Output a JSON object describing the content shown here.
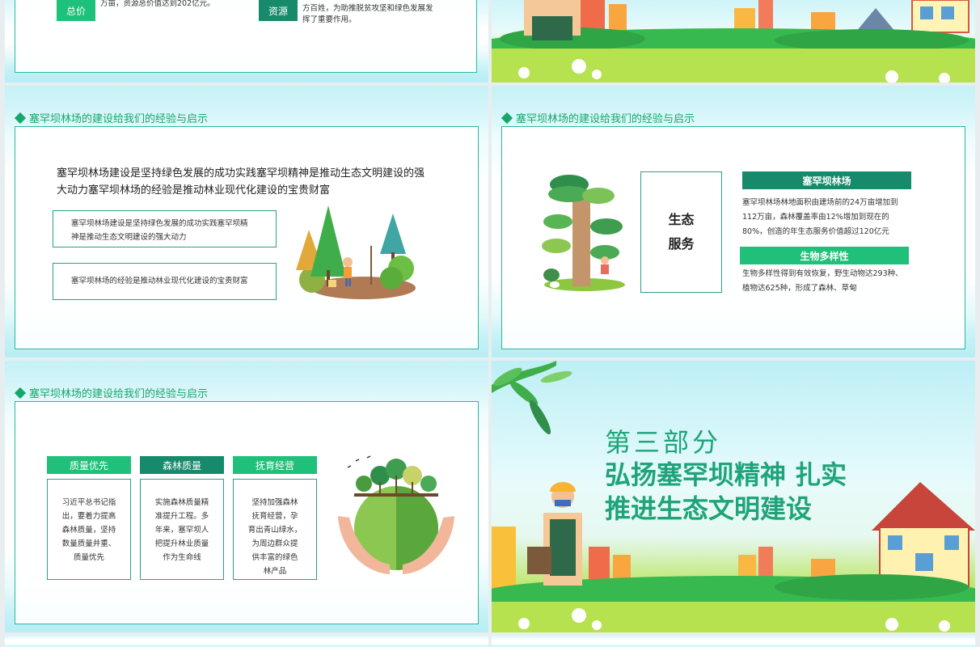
{
  "slide1": {
    "label_a": "总价",
    "text_a": "万亩，资源总价值达到202亿元。",
    "label_b": "资源",
    "text_b_line1": "方百姓，为助推脱贫攻坚和绿色发展发",
    "text_b_line2": "挥了重要作用。"
  },
  "slide3": {
    "heading": "塞罕坝林场的建设给我们的经验与启示",
    "main_line1": "塞罕坝林场建设是坚持绿色发展的成功实践塞罕坝精神是推动生态文明建设的强",
    "main_line2": "大动力塞罕坝林场的经验是推动林业现代化建设的宝贵财富",
    "box1_line1": "塞罕坝林场建设是坚持绿色发展的成功实践塞罕坝精",
    "box1_line2": "神是推动生态文明建设的强大动力",
    "box2": "塞罕坝林场的经验是推动林业现代化建设的宝贵财富"
  },
  "slide4": {
    "heading": "塞罕坝林场的建设给我们的经验与启示",
    "center_line1": "生态",
    "center_line2": "服务",
    "tag1": "塞罕坝林场",
    "desc1_line1": "塞罕坝林场林地面积由建场前的24万亩增加到",
    "desc1_line2": "112万亩，森林覆盖率由12%增加到现在的",
    "desc1_line3": "80%，创造的年生态服务价值超过120亿元",
    "tag2": "生物多样性",
    "desc2_line1": "生物多样性得到有效恢复，野生动物达293种、",
    "desc2_line2": "植物达625种，形成了森林、草甸"
  },
  "slide5": {
    "heading": "塞罕坝林场的建设给我们的经验与启示",
    "cards": [
      {
        "title": "质量优先",
        "lines": [
          "习近平总书记指",
          "出，要着力提高",
          "森林质量，坚持",
          "数量质量并重、",
          "质量优先"
        ]
      },
      {
        "title": "森林质量",
        "lines": [
          "实施森林质量精",
          "准提升工程。多",
          "年来，塞罕坝人",
          "把提升林业质量",
          "作为生命线"
        ]
      },
      {
        "title": "抚育经营",
        "lines": [
          "坚持加强森林",
          "抚育经营，孕",
          "育出青山绿水，",
          "为周边群众提",
          "供丰富的绿色",
          "林产品"
        ]
      }
    ]
  },
  "slide6": {
    "part": "第三部分",
    "title_line1": "弘扬塞罕坝精神 扎实",
    "title_line2": "推进生态文明建设"
  },
  "colors": {
    "green": "#21c07a",
    "dark_green": "#168a6b",
    "title_teal": "#1ea37a"
  }
}
